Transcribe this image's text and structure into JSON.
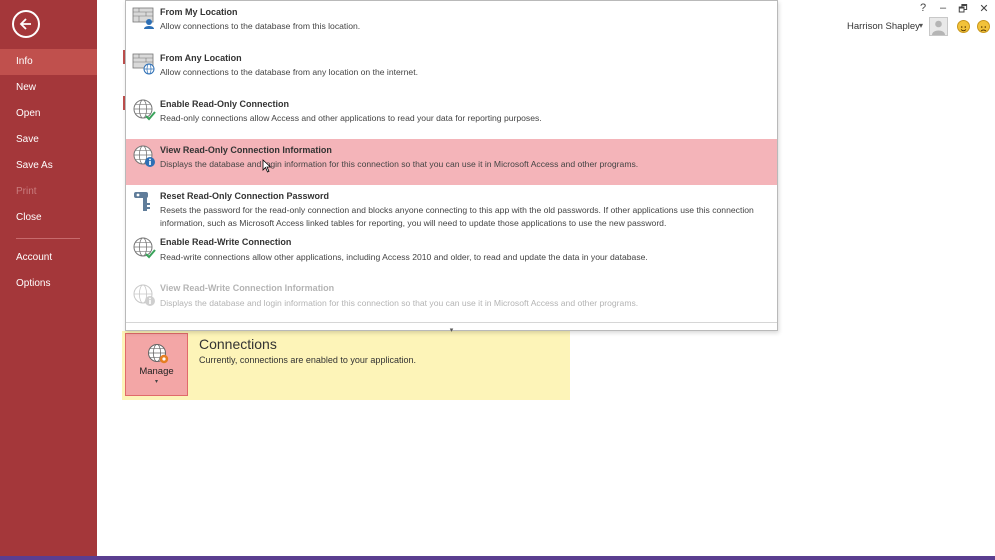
{
  "nav": {
    "items": [
      {
        "label": "Info",
        "state": "active"
      },
      {
        "label": "New",
        "state": "normal"
      },
      {
        "label": "Open",
        "state": "normal"
      },
      {
        "label": "Save",
        "state": "normal"
      },
      {
        "label": "Save As",
        "state": "normal"
      },
      {
        "label": "Print",
        "state": "disabled"
      },
      {
        "label": "Close",
        "state": "normal"
      },
      {
        "label": "Account",
        "state": "normal"
      },
      {
        "label": "Options",
        "state": "normal"
      }
    ],
    "back_icon": "back-arrow-icon"
  },
  "window": {
    "help": "?",
    "minimize": "–",
    "restore": "🗗",
    "close": "✕"
  },
  "user": {
    "name": "Harrison Shapley",
    "caret": "▾"
  },
  "menu": {
    "items": [
      {
        "title": "From My Location",
        "desc": "Allow connections to the database from this location.",
        "icon": "firewall-user-icon"
      },
      {
        "title": "From Any Location",
        "desc": "Allow connections to the database from any location on the internet.",
        "icon": "firewall-globe-icon"
      },
      {
        "title": "Enable Read-Only Connection",
        "desc": "Read-only connections allow Access and other applications to read your data for reporting purposes.",
        "icon": "globe-check-icon"
      },
      {
        "title": "View Read-Only Connection Information",
        "desc": "Displays the database and login information for this connection so that you can use it in Microsoft Access and other programs.",
        "icon": "globe-info-icon"
      },
      {
        "title": "Reset Read-Only Connection Password",
        "desc": "Resets the password for the read-only connection and blocks anyone connecting to this app with the old passwords. If other applications use this connection information, such as Microsoft Access linked tables for reporting, you will need to update those applications to use the new password.",
        "icon": "key-icon"
      },
      {
        "title": "Enable Read-Write Connection",
        "desc": "Read-write connections allow other applications, including Access 2010 and older, to read and update the data in your database.",
        "icon": "globe-check-icon"
      },
      {
        "title": "View Read-Write Connection Information",
        "desc": "Displays the database and login information for this connection so that you can use it in Microsoft Access and other programs.",
        "icon": "globe-info-icon"
      }
    ],
    "scroll_glyph": "▾"
  },
  "connections": {
    "button_label": "Manage",
    "button_caret": "▾",
    "title": "Connections",
    "desc": "Currently, connections are enabled to your application."
  },
  "colors": {
    "nav_bg": "#a4373a",
    "nav_active": "#c0504d",
    "highlight": "#f4b4b9",
    "panel_bg": "#fdf4b8"
  }
}
